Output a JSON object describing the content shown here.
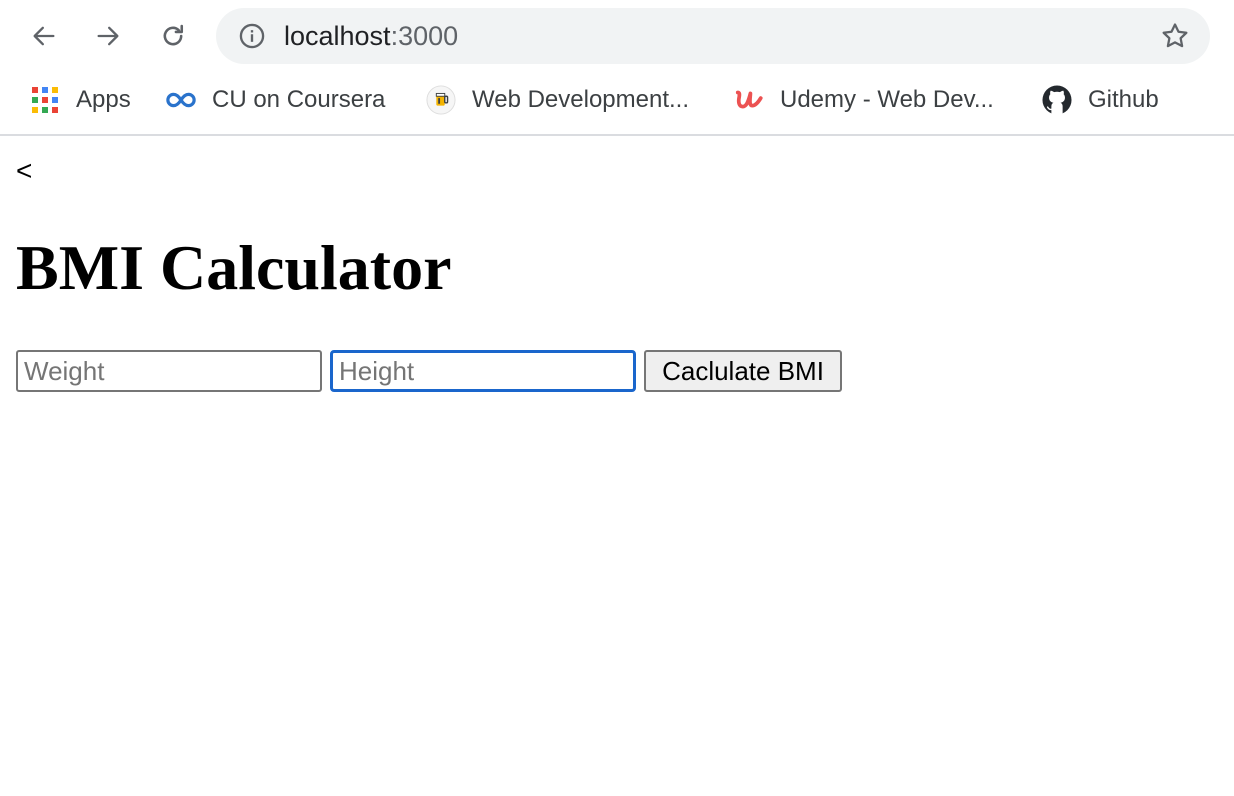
{
  "browser": {
    "address": {
      "host": "localhost",
      "port": ":3000"
    },
    "bookmarks": [
      {
        "label": "Apps",
        "icon": "apps-grid-icon"
      },
      {
        "label": "CU on Coursera",
        "icon": "coursera-icon"
      },
      {
        "label": "Web Development...",
        "icon": "web-dev-icon"
      },
      {
        "label": "Udemy - Web Dev...",
        "icon": "udemy-icon"
      },
      {
        "label": "Github",
        "icon": "github-icon"
      }
    ]
  },
  "page": {
    "back_link": "<",
    "title": "BMI Calculator",
    "weight_placeholder": "Weight",
    "height_placeholder": "Height",
    "calculate_label": "Caclulate BMI"
  },
  "colors": {
    "focus_ring": "#1a66cc",
    "udemy": "#ec5252",
    "coursera": "#2a73cc"
  }
}
